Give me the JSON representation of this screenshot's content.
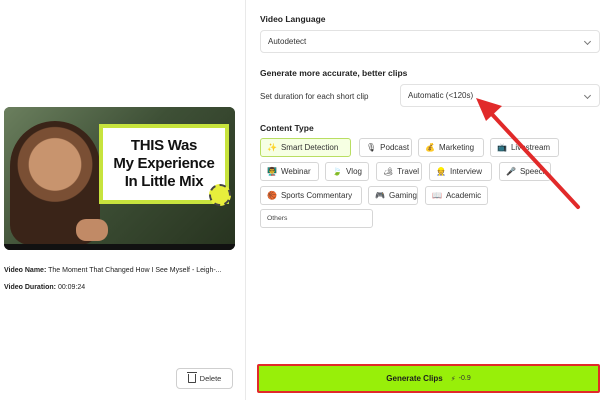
{
  "video": {
    "thumbnail_text": [
      "THIS Was",
      "My Experience",
      "In Little Mix"
    ],
    "name_label": "Video Name:",
    "name_value": "The Moment That Changed How I See Myself - Leigh-...",
    "duration_label": "Video Duration:",
    "duration_value": "00:09:24",
    "delete_label": "Delete"
  },
  "settings": {
    "language_label": "Video Language",
    "language_value": "Autodetect",
    "accuracy_heading": "Generate more accurate, better clips",
    "duration_label": "Set duration for each short clip",
    "duration_value": "Automatic (<120s)",
    "content_type_label": "Content Type"
  },
  "content_types": [
    {
      "label": "Smart Detection",
      "icon": "✨",
      "icon_name": "sparkle-icon",
      "active": true
    },
    {
      "label": "Podcast",
      "icon": "🎙",
      "icon_name": "microphone-icon",
      "active": false
    },
    {
      "label": "Marketing",
      "icon": "💰",
      "icon_name": "money-bag-icon",
      "active": false
    },
    {
      "label": "Livestream",
      "icon": "📺",
      "icon_name": "tv-icon",
      "active": false
    },
    {
      "label": "Webinar",
      "icon": "👨‍🏫",
      "icon_name": "teacher-icon",
      "active": false
    },
    {
      "label": "Vlog",
      "icon": "🍃",
      "icon_name": "leaf-icon",
      "active": false
    },
    {
      "label": "Travel",
      "icon": "🏕",
      "icon_name": "camping-icon",
      "active": false
    },
    {
      "label": "Interview",
      "icon": "👷",
      "icon_name": "person-icon",
      "active": false
    },
    {
      "label": "Speech",
      "icon": "🎤",
      "icon_name": "mic-icon",
      "active": false
    },
    {
      "label": "Sports Commentary",
      "icon": "🏀",
      "icon_name": "basketball-icon",
      "active": false
    },
    {
      "label": "Gaming",
      "icon": "🎮",
      "icon_name": "gamepad-icon",
      "active": false
    },
    {
      "label": "Academic",
      "icon": "📖",
      "icon_name": "book-icon",
      "active": false
    },
    {
      "label": "Others",
      "icon": "",
      "icon_name": "",
      "active": false
    }
  ],
  "generate": {
    "label": "Generate Clips",
    "cost": "-0.9",
    "cost_icon": "⚡"
  },
  "colors": {
    "generate_bg": "#98ef09",
    "annotation_red": "#e12a2a",
    "active_chip_border": "#b9de62"
  }
}
